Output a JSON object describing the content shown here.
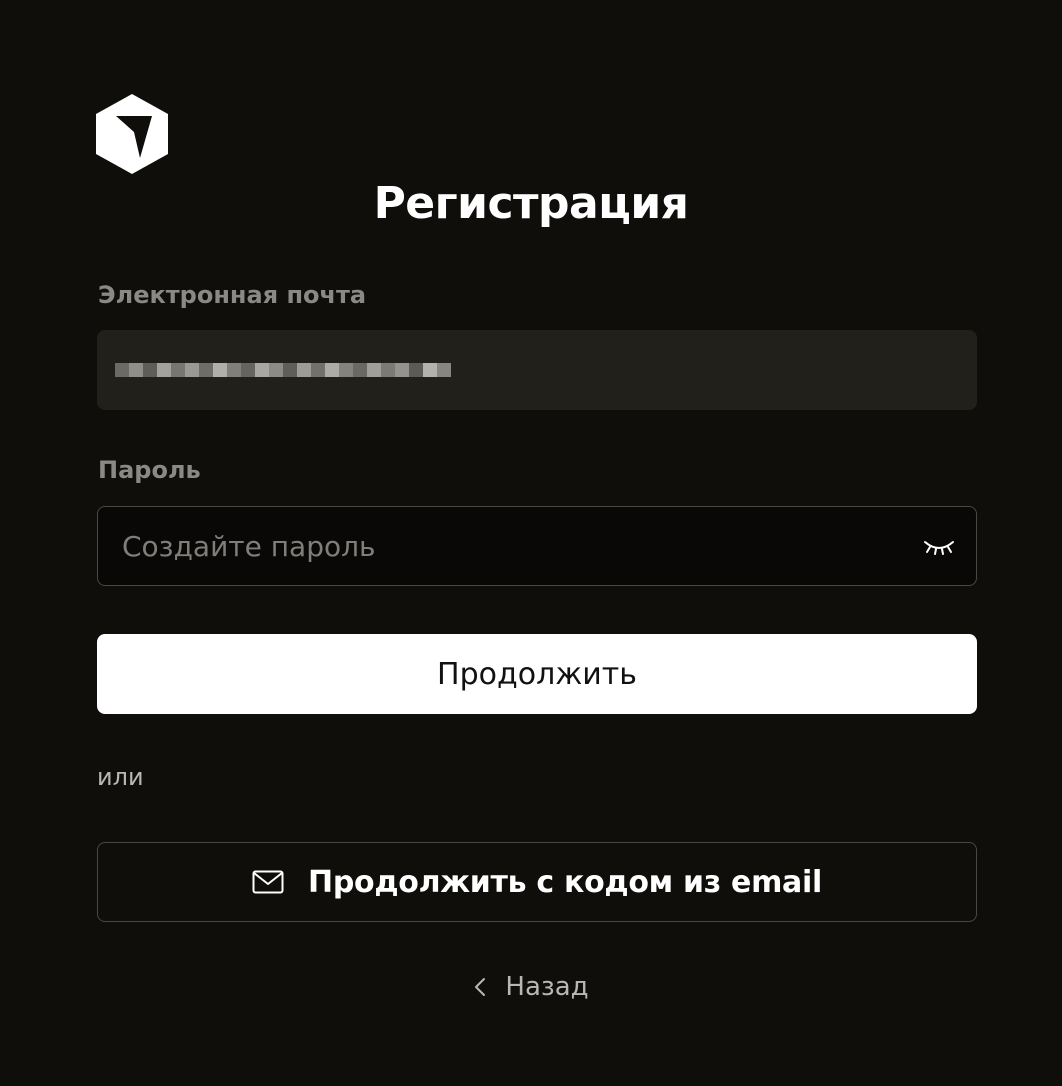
{
  "header": {
    "title": "Регистрация"
  },
  "form": {
    "email_label": "Электронная почта",
    "password_label": "Пароль",
    "password_placeholder": "Создайте пароль",
    "continue_label": "Продолжить",
    "or_text": "или",
    "email_code_label": "Продолжить с кодом из email",
    "back_label": "Назад"
  },
  "colors": {
    "background": "#0f0e0b",
    "email_field_bg": "#22201a",
    "label": "#8a8985",
    "primary_button_bg": "#ffffff",
    "border": "#4a4841"
  },
  "icons": {
    "logo": "cube-arrow-logo-icon",
    "password_toggle": "eye-closed-icon",
    "email_button": "envelope-icon",
    "back": "chevron-left-icon"
  }
}
